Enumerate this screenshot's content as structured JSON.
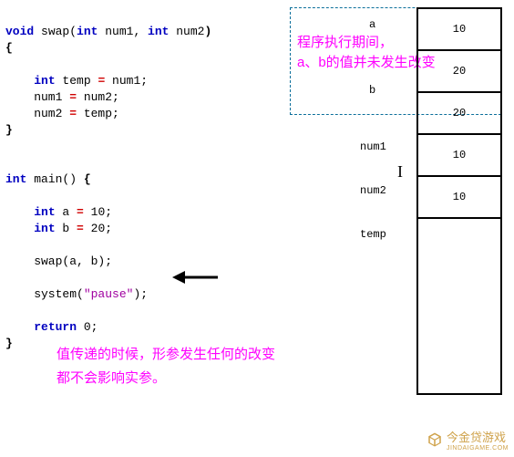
{
  "code": {
    "l1a": "void",
    "l1b": " swap(",
    "l1c": "int",
    "l1d": " num1, ",
    "l1e": "int",
    "l1f": " num2",
    "l1g": ")",
    "l2": "{",
    "l3a": "    ",
    "l3b": "int",
    "l3c": " temp ",
    "l3d": "=",
    "l3e": " num1;",
    "l4a": "    num1 ",
    "l4b": "=",
    "l4c": " num2;",
    "l5a": "    num2 ",
    "l5b": "=",
    "l5c": " temp;",
    "l6": "}",
    "l7a": "int",
    "l7b": " main() ",
    "l7c": "{",
    "l8a": "    ",
    "l8b": "int",
    "l8c": " a ",
    "l8d": "=",
    "l8e": " 10;",
    "l9a": "    ",
    "l9b": "int",
    "l9c": " b ",
    "l9d": "=",
    "l9e": " 20;",
    "l10": "    swap(a, b);",
    "l11a": "    system(",
    "l11b": "\"pause\"",
    "l11c": ");",
    "l12a": "    ",
    "l12b": "return",
    "l12c": " 0;",
    "l13": "}"
  },
  "annot1": {
    "line1": "程序执行期间，",
    "line2": "a、b的值并未发生改变"
  },
  "annot2": {
    "line1": "值传递的时候，形参发生任何的改变",
    "line2": "都不会影响实参。"
  },
  "mem": {
    "labels": {
      "a": "a",
      "b": "b",
      "num1": "num1",
      "num2": "num2",
      "temp": "temp"
    },
    "vals": {
      "a": "10",
      "b": "20",
      "num1": "20",
      "num2": "10",
      "temp": "10"
    }
  },
  "logo": {
    "text": "今金贷游戏",
    "sub": "JINDAIGAME.COM"
  }
}
